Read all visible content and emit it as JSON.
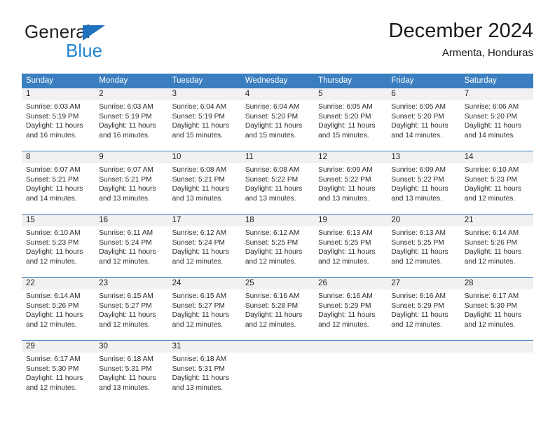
{
  "brand": {
    "name_top": "General",
    "name_bottom": "Blue",
    "triangle_color": "#1f72bd",
    "blue_color": "#1f86d0"
  },
  "header": {
    "title": "December 2024",
    "subtitle": "Armenta, Honduras"
  },
  "theme": {
    "header_blue": "#3a7ebf",
    "day_number_bg": "#f1f1f1",
    "text_color": "#2b2b2b"
  },
  "weekdays": [
    "Sunday",
    "Monday",
    "Tuesday",
    "Wednesday",
    "Thursday",
    "Friday",
    "Saturday"
  ],
  "weeks": [
    {
      "days": [
        {
          "number": "1",
          "info": "Sunrise: 6:03 AM\nSunset: 5:19 PM\nDaylight: 11 hours\nand 16 minutes."
        },
        {
          "number": "2",
          "info": "Sunrise: 6:03 AM\nSunset: 5:19 PM\nDaylight: 11 hours\nand 16 minutes."
        },
        {
          "number": "3",
          "info": "Sunrise: 6:04 AM\nSunset: 5:19 PM\nDaylight: 11 hours\nand 15 minutes."
        },
        {
          "number": "4",
          "info": "Sunrise: 6:04 AM\nSunset: 5:20 PM\nDaylight: 11 hours\nand 15 minutes."
        },
        {
          "number": "5",
          "info": "Sunrise: 6:05 AM\nSunset: 5:20 PM\nDaylight: 11 hours\nand 15 minutes."
        },
        {
          "number": "6",
          "info": "Sunrise: 6:05 AM\nSunset: 5:20 PM\nDaylight: 11 hours\nand 14 minutes."
        },
        {
          "number": "7",
          "info": "Sunrise: 6:06 AM\nSunset: 5:20 PM\nDaylight: 11 hours\nand 14 minutes."
        }
      ]
    },
    {
      "days": [
        {
          "number": "8",
          "info": "Sunrise: 6:07 AM\nSunset: 5:21 PM\nDaylight: 11 hours\nand 14 minutes."
        },
        {
          "number": "9",
          "info": "Sunrise: 6:07 AM\nSunset: 5:21 PM\nDaylight: 11 hours\nand 13 minutes."
        },
        {
          "number": "10",
          "info": "Sunrise: 6:08 AM\nSunset: 5:21 PM\nDaylight: 11 hours\nand 13 minutes."
        },
        {
          "number": "11",
          "info": "Sunrise: 6:08 AM\nSunset: 5:22 PM\nDaylight: 11 hours\nand 13 minutes."
        },
        {
          "number": "12",
          "info": "Sunrise: 6:09 AM\nSunset: 5:22 PM\nDaylight: 11 hours\nand 13 minutes."
        },
        {
          "number": "13",
          "info": "Sunrise: 6:09 AM\nSunset: 5:22 PM\nDaylight: 11 hours\nand 13 minutes."
        },
        {
          "number": "14",
          "info": "Sunrise: 6:10 AM\nSunset: 5:23 PM\nDaylight: 11 hours\nand 12 minutes."
        }
      ]
    },
    {
      "days": [
        {
          "number": "15",
          "info": "Sunrise: 6:10 AM\nSunset: 5:23 PM\nDaylight: 11 hours\nand 12 minutes."
        },
        {
          "number": "16",
          "info": "Sunrise: 6:11 AM\nSunset: 5:24 PM\nDaylight: 11 hours\nand 12 minutes."
        },
        {
          "number": "17",
          "info": "Sunrise: 6:12 AM\nSunset: 5:24 PM\nDaylight: 11 hours\nand 12 minutes."
        },
        {
          "number": "18",
          "info": "Sunrise: 6:12 AM\nSunset: 5:25 PM\nDaylight: 11 hours\nand 12 minutes."
        },
        {
          "number": "19",
          "info": "Sunrise: 6:13 AM\nSunset: 5:25 PM\nDaylight: 11 hours\nand 12 minutes."
        },
        {
          "number": "20",
          "info": "Sunrise: 6:13 AM\nSunset: 5:25 PM\nDaylight: 11 hours\nand 12 minutes."
        },
        {
          "number": "21",
          "info": "Sunrise: 6:14 AM\nSunset: 5:26 PM\nDaylight: 11 hours\nand 12 minutes."
        }
      ]
    },
    {
      "days": [
        {
          "number": "22",
          "info": "Sunrise: 6:14 AM\nSunset: 5:26 PM\nDaylight: 11 hours\nand 12 minutes."
        },
        {
          "number": "23",
          "info": "Sunrise: 6:15 AM\nSunset: 5:27 PM\nDaylight: 11 hours\nand 12 minutes."
        },
        {
          "number": "24",
          "info": "Sunrise: 6:15 AM\nSunset: 5:27 PM\nDaylight: 11 hours\nand 12 minutes."
        },
        {
          "number": "25",
          "info": "Sunrise: 6:16 AM\nSunset: 5:28 PM\nDaylight: 11 hours\nand 12 minutes."
        },
        {
          "number": "26",
          "info": "Sunrise: 6:16 AM\nSunset: 5:29 PM\nDaylight: 11 hours\nand 12 minutes."
        },
        {
          "number": "27",
          "info": "Sunrise: 6:16 AM\nSunset: 5:29 PM\nDaylight: 11 hours\nand 12 minutes."
        },
        {
          "number": "28",
          "info": "Sunrise: 6:17 AM\nSunset: 5:30 PM\nDaylight: 11 hours\nand 12 minutes."
        }
      ]
    },
    {
      "days": [
        {
          "number": "29",
          "info": "Sunrise: 6:17 AM\nSunset: 5:30 PM\nDaylight: 11 hours\nand 12 minutes."
        },
        {
          "number": "30",
          "info": "Sunrise: 6:18 AM\nSunset: 5:31 PM\nDaylight: 11 hours\nand 13 minutes."
        },
        {
          "number": "31",
          "info": "Sunrise: 6:18 AM\nSunset: 5:31 PM\nDaylight: 11 hours\nand 13 minutes."
        },
        {
          "number": "",
          "info": ""
        },
        {
          "number": "",
          "info": ""
        },
        {
          "number": "",
          "info": ""
        },
        {
          "number": "",
          "info": ""
        }
      ]
    }
  ]
}
